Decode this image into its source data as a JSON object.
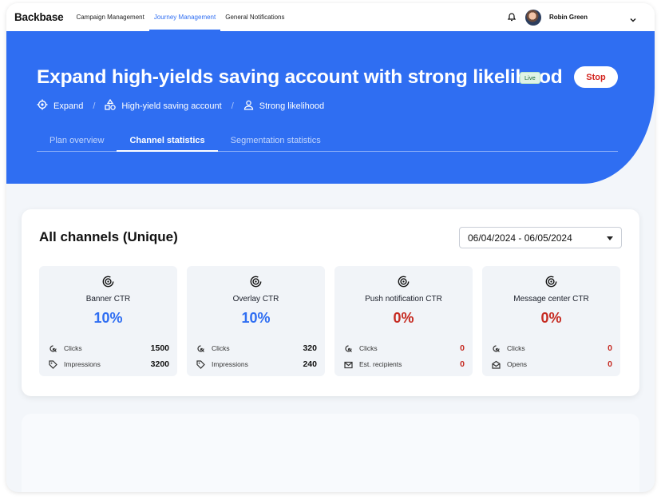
{
  "app": {
    "logo": "Backbase"
  },
  "nav": [
    {
      "label": "Campaign Management",
      "active": false
    },
    {
      "label": "Journey Management",
      "active": true
    },
    {
      "label": "General Notifications",
      "active": false
    }
  ],
  "user": {
    "name": "Robin Green"
  },
  "hero": {
    "title": "Expand high-yields saving account with strong likelihood",
    "badge": "Live",
    "stop_label": "Stop",
    "meta": [
      {
        "icon": "target-icon",
        "label": "Expand"
      },
      {
        "icon": "shapes-icon",
        "label": "High-yield saving account"
      },
      {
        "icon": "person-icon",
        "label": "Strong likelihood"
      }
    ],
    "meta_separator": "/",
    "tabs": [
      {
        "label": "Plan overview",
        "active": false
      },
      {
        "label": "Channel statistics",
        "active": true
      },
      {
        "label": "Segmentation statistics",
        "active": false
      }
    ]
  },
  "card": {
    "title": "All channels (Unique)",
    "date_range": "06/04/2024 - 06/05/2024",
    "stats": [
      {
        "name": "Banner CTR",
        "value": "10%",
        "tone": "blue",
        "rows": [
          {
            "icon": "click-icon",
            "label": "Clicks",
            "value": "1500",
            "tone": "dark"
          },
          {
            "icon": "tag-icon",
            "label": "Impressions",
            "value": "3200",
            "tone": "dark"
          }
        ]
      },
      {
        "name": "Overlay CTR",
        "value": "10%",
        "tone": "blue",
        "rows": [
          {
            "icon": "click-icon",
            "label": "Clicks",
            "value": "320",
            "tone": "dark"
          },
          {
            "icon": "tag-icon",
            "label": "Impressions",
            "value": "240",
            "tone": "dark"
          }
        ]
      },
      {
        "name": "Push notification CTR",
        "value": "0%",
        "tone": "red",
        "rows": [
          {
            "icon": "click-icon",
            "label": "Clicks",
            "value": "0",
            "tone": "red"
          },
          {
            "icon": "mail-icon",
            "label": "Est. recipients",
            "value": "0",
            "tone": "red"
          }
        ]
      },
      {
        "name": "Message center CTR",
        "value": "0%",
        "tone": "red",
        "rows": [
          {
            "icon": "click-icon",
            "label": "Clicks",
            "value": "0",
            "tone": "red"
          },
          {
            "icon": "envelope-open-icon",
            "label": "Opens",
            "value": "0",
            "tone": "red"
          }
        ]
      }
    ]
  },
  "colors": {
    "primary": "#2f6ef2",
    "danger": "#c62b22",
    "live": "#1d6b3a"
  }
}
